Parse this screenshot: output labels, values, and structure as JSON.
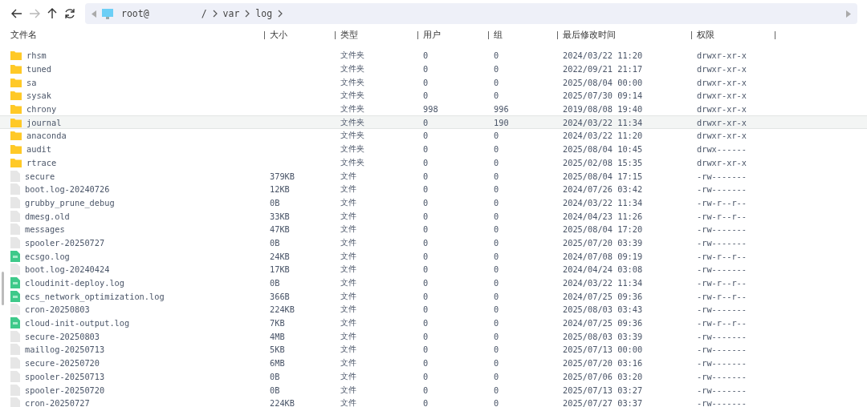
{
  "toolbar": {
    "back_disabled": false,
    "forward_disabled": true
  },
  "address": {
    "host": "root@",
    "segments": [
      "/",
      "var",
      "log"
    ]
  },
  "columns": [
    "文件名",
    "大小",
    "类型",
    "用户",
    "组",
    "最后修改时间",
    "权限"
  ],
  "rows": [
    {
      "kind": "folder",
      "name": "rhsm",
      "size": "",
      "type": "文件夹",
      "user": "0",
      "group": "0",
      "modified": "2024/03/22 11:20",
      "perm": "drwxr-xr-x",
      "selected": false
    },
    {
      "kind": "folder",
      "name": "tuned",
      "size": "",
      "type": "文件夹",
      "user": "0",
      "group": "0",
      "modified": "2022/09/21 21:17",
      "perm": "drwxr-xr-x",
      "selected": false
    },
    {
      "kind": "folder",
      "name": "sa",
      "size": "",
      "type": "文件夹",
      "user": "0",
      "group": "0",
      "modified": "2025/08/04 00:00",
      "perm": "drwxr-xr-x",
      "selected": false
    },
    {
      "kind": "folder",
      "name": "sysak",
      "size": "",
      "type": "文件夹",
      "user": "0",
      "group": "0",
      "modified": "2025/07/30 09:14",
      "perm": "drwxr-xr-x",
      "selected": false
    },
    {
      "kind": "folder",
      "name": "chrony",
      "size": "",
      "type": "文件夹",
      "user": "998",
      "group": "996",
      "modified": "2019/08/08 19:40",
      "perm": "drwxr-xr-x",
      "selected": false
    },
    {
      "kind": "folder",
      "name": "journal",
      "size": "",
      "type": "文件夹",
      "user": "0",
      "group": "190",
      "modified": "2024/03/22 11:34",
      "perm": "drwxr-xr-x",
      "selected": true
    },
    {
      "kind": "folder",
      "name": "anaconda",
      "size": "",
      "type": "文件夹",
      "user": "0",
      "group": "0",
      "modified": "2024/03/22 11:20",
      "perm": "drwxr-xr-x",
      "selected": false
    },
    {
      "kind": "folder",
      "name": "audit",
      "size": "",
      "type": "文件夹",
      "user": "0",
      "group": "0",
      "modified": "2025/08/04 10:45",
      "perm": "drwx------",
      "selected": false
    },
    {
      "kind": "folder",
      "name": "rtrace",
      "size": "",
      "type": "文件夹",
      "user": "0",
      "group": "0",
      "modified": "2025/02/08 15:35",
      "perm": "drwxr-xr-x",
      "selected": false
    },
    {
      "kind": "file",
      "name": "secure",
      "size": "379KB",
      "type": "文件",
      "user": "0",
      "group": "0",
      "modified": "2025/08/04 17:15",
      "perm": "-rw-------",
      "selected": false
    },
    {
      "kind": "file",
      "name": "boot.log-20240726",
      "size": "12KB",
      "type": "文件",
      "user": "0",
      "group": "0",
      "modified": "2024/07/26 03:42",
      "perm": "-rw-------",
      "selected": false
    },
    {
      "kind": "file",
      "name": "grubby_prune_debug",
      "size": "0B",
      "type": "文件",
      "user": "0",
      "group": "0",
      "modified": "2024/03/22 11:34",
      "perm": "-rw-r--r--",
      "selected": false
    },
    {
      "kind": "file",
      "name": "dmesg.old",
      "size": "33KB",
      "type": "文件",
      "user": "0",
      "group": "0",
      "modified": "2024/04/23 11:26",
      "perm": "-rw-r--r--",
      "selected": false
    },
    {
      "kind": "file",
      "name": "messages",
      "size": "47KB",
      "type": "文件",
      "user": "0",
      "group": "0",
      "modified": "2025/08/04 17:20",
      "perm": "-rw-------",
      "selected": false
    },
    {
      "kind": "file",
      "name": "spooler-20250727",
      "size": "0B",
      "type": "文件",
      "user": "0",
      "group": "0",
      "modified": "2025/07/20 03:39",
      "perm": "-rw-------",
      "selected": false
    },
    {
      "kind": "log",
      "name": "ecsgo.log",
      "size": "24KB",
      "type": "文件",
      "user": "0",
      "group": "0",
      "modified": "2024/07/08 09:19",
      "perm": "-rw-r--r--",
      "selected": false
    },
    {
      "kind": "file",
      "name": "boot.log-20240424",
      "size": "17KB",
      "type": "文件",
      "user": "0",
      "group": "0",
      "modified": "2024/04/24 03:08",
      "perm": "-rw-------",
      "selected": false
    },
    {
      "kind": "log",
      "name": "cloudinit-deploy.log",
      "size": "0B",
      "type": "文件",
      "user": "0",
      "group": "0",
      "modified": "2024/03/22 11:34",
      "perm": "-rw-r--r--",
      "selected": false
    },
    {
      "kind": "log",
      "name": "ecs_network_optimization.log",
      "size": "366B",
      "type": "文件",
      "user": "0",
      "group": "0",
      "modified": "2024/07/25 09:36",
      "perm": "-rw-r--r--",
      "selected": false
    },
    {
      "kind": "file",
      "name": "cron-20250803",
      "size": "224KB",
      "type": "文件",
      "user": "0",
      "group": "0",
      "modified": "2025/08/03 03:43",
      "perm": "-rw-------",
      "selected": false
    },
    {
      "kind": "log",
      "name": "cloud-init-output.log",
      "size": "7KB",
      "type": "文件",
      "user": "0",
      "group": "0",
      "modified": "2024/07/25 09:36",
      "perm": "-rw-r--r--",
      "selected": false
    },
    {
      "kind": "file",
      "name": "secure-20250803",
      "size": "4MB",
      "type": "文件",
      "user": "0",
      "group": "0",
      "modified": "2025/08/03 03:39",
      "perm": "-rw-------",
      "selected": false
    },
    {
      "kind": "file",
      "name": "maillog-20250713",
      "size": "5KB",
      "type": "文件",
      "user": "0",
      "group": "0",
      "modified": "2025/07/13 00:00",
      "perm": "-rw-------",
      "selected": false
    },
    {
      "kind": "file",
      "name": "secure-20250720",
      "size": "6MB",
      "type": "文件",
      "user": "0",
      "group": "0",
      "modified": "2025/07/20 03:16",
      "perm": "-rw-------",
      "selected": false
    },
    {
      "kind": "file",
      "name": "spooler-20250713",
      "size": "0B",
      "type": "文件",
      "user": "0",
      "group": "0",
      "modified": "2025/07/06 03:20",
      "perm": "-rw-------",
      "selected": false
    },
    {
      "kind": "file",
      "name": "spooler-20250720",
      "size": "0B",
      "type": "文件",
      "user": "0",
      "group": "0",
      "modified": "2025/07/13 03:27",
      "perm": "-rw-------",
      "selected": false
    },
    {
      "kind": "file",
      "name": "cron-20250727",
      "size": "224KB",
      "type": "文件",
      "user": "0",
      "group": "0",
      "modified": "2025/07/27 03:37",
      "perm": "-rw-------",
      "selected": false
    }
  ]
}
